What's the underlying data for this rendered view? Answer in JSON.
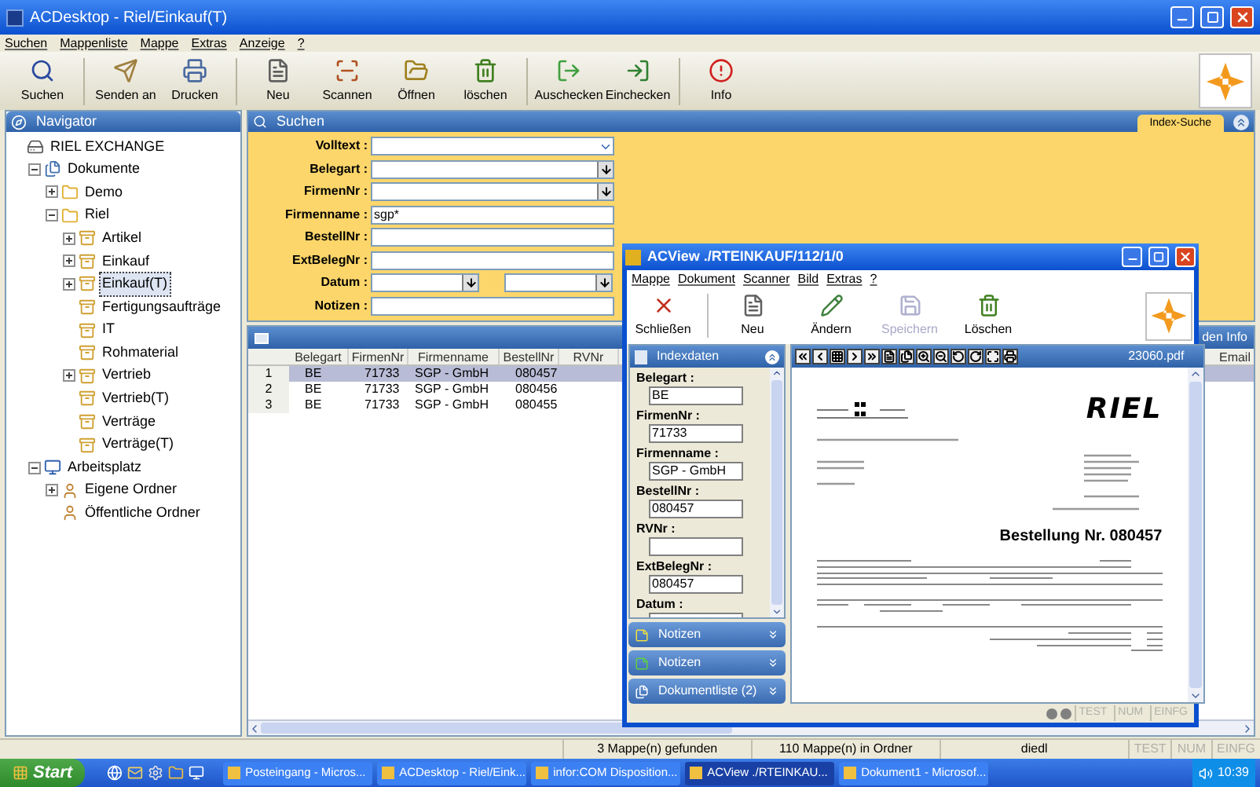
{
  "window": {
    "title": "ACDesktop - Riel/Einkauf(T)"
  },
  "menu": [
    "Suchen",
    "Mappenliste",
    "Mappe",
    "Extras",
    "Anzeige",
    "?"
  ],
  "toolbar": [
    {
      "label": "Suchen",
      "kind": "search"
    },
    {
      "label": "Senden an",
      "kind": "send",
      "separator_before": true
    },
    {
      "label": "Drucken",
      "kind": "print"
    },
    {
      "label": "Neu",
      "kind": "new",
      "separator_before": true
    },
    {
      "label": "Scannen",
      "kind": "scan"
    },
    {
      "label": "Öffnen",
      "kind": "open"
    },
    {
      "label": "löschen",
      "kind": "delete"
    },
    {
      "label": "Auschecken",
      "kind": "checkout",
      "separator_before": true
    },
    {
      "label": "Einchecken",
      "kind": "checkin"
    },
    {
      "label": "Info",
      "kind": "info",
      "separator_before": true
    }
  ],
  "navigator": {
    "title": "Navigator",
    "tree": [
      {
        "label": "RIEL EXCHANGE",
        "kind": "root",
        "selected": false,
        "children": [
          {
            "label": "Dokumente",
            "kind": "docs",
            "expanded": true,
            "selected": false,
            "children": [
              {
                "label": "Demo",
                "kind": "folder",
                "expanded": false,
                "selected": false
              },
              {
                "label": "Riel",
                "kind": "folder",
                "expanded": true,
                "selected": false,
                "children": [
                  {
                    "label": "Artikel",
                    "kind": "archive",
                    "expanded": false,
                    "selected": false
                  },
                  {
                    "label": "Einkauf",
                    "kind": "archive",
                    "expanded": false,
                    "selected": false
                  },
                  {
                    "label": "Einkauf(T)",
                    "kind": "archive",
                    "expanded": false,
                    "selected": true
                  },
                  {
                    "label": "Fertigungsaufträge",
                    "kind": "archive",
                    "selected": false
                  },
                  {
                    "label": "IT",
                    "kind": "archive",
                    "selected": false
                  },
                  {
                    "label": "Rohmaterial",
                    "kind": "archive",
                    "selected": false
                  },
                  {
                    "label": "Vertrieb",
                    "kind": "archive",
                    "expanded": false,
                    "selected": false
                  },
                  {
                    "label": "Vertrieb(T)",
                    "kind": "archive",
                    "selected": false
                  },
                  {
                    "label": "Verträge",
                    "kind": "archive",
                    "selected": false
                  },
                  {
                    "label": "Verträge(T)",
                    "kind": "archive",
                    "selected": false
                  }
                ]
              }
            ]
          },
          {
            "label": "Arbeitsplatz",
            "kind": "workplace",
            "expanded": true,
            "selected": false,
            "children": [
              {
                "label": "Eigene Ordner",
                "kind": "user",
                "expanded": false,
                "selected": false
              },
              {
                "label": "Öffentliche Ordner",
                "kind": "user",
                "selected": false
              }
            ]
          }
        ]
      }
    ]
  },
  "search": {
    "title": "Suchen",
    "tab": "Index-Suche",
    "fields": [
      {
        "label": "Volltext :",
        "kind": "dropdown"
      },
      {
        "label": "Belegart :",
        "kind": "combo"
      },
      {
        "label": "FirmenNr :",
        "kind": "combo"
      },
      {
        "label": "Firmenname :",
        "kind": "text",
        "value": "sgp*"
      },
      {
        "label": "BestellNr :",
        "kind": "text"
      },
      {
        "label": "ExtBelegNr :",
        "kind": "text"
      },
      {
        "label": "Datum :",
        "kind": "range"
      },
      {
        "label": "Notizen :",
        "kind": "text"
      }
    ]
  },
  "results": {
    "header_text": "den Info",
    "columns": [
      "Belegart",
      "FirmenNr",
      "Firmenname",
      "BestellNr",
      "RVNr",
      "Email"
    ],
    "rows": [
      {
        "number": "1",
        "cells": [
          "BE",
          "71733",
          "SGP - GmbH",
          "080457"
        ],
        "selected": true
      },
      {
        "number": "2",
        "cells": [
          "BE",
          "71733",
          "SGP - GmbH",
          "080456"
        ],
        "selected": false
      },
      {
        "number": "3",
        "cells": [
          "BE",
          "71733",
          "SGP - GmbH",
          "080455"
        ],
        "selected": false
      }
    ]
  },
  "status_bar": {
    "texts": [
      "3 Mappe(n) gefunden",
      "110 Mappe(n) in Ordner",
      "diedl"
    ],
    "indicators": [
      "TEST",
      "NUM",
      "EINFG"
    ]
  },
  "dialog": {
    "title": "ACView ./RTEINKAUF/112/1/0",
    "menu": [
      "Mappe",
      "Dokument",
      "Scanner",
      "Bild",
      "Extras",
      "?"
    ],
    "toolbar": [
      {
        "label": "Schließen",
        "kind": "close",
        "disabled": false
      },
      {
        "label": "Neu",
        "kind": "new",
        "disabled": false,
        "separator_before": true
      },
      {
        "label": "Ändern",
        "kind": "edit",
        "disabled": false
      },
      {
        "label": "Speichern",
        "kind": "save",
        "disabled": true
      },
      {
        "label": "Löschen",
        "kind": "delete",
        "disabled": false
      }
    ],
    "index_panel": {
      "title": "Indexdaten",
      "fields": [
        {
          "label": "Belegart :",
          "value": "BE"
        },
        {
          "label": "FirmenNr :",
          "value": "71733"
        },
        {
          "label": "Firmenname :",
          "value": "SGP - GmbH"
        },
        {
          "label": "BestellNr :",
          "value": "080457"
        },
        {
          "label": "RVNr :"
        },
        {
          "label": "ExtBelegNr :",
          "value": "080457"
        },
        {
          "label": "Datum :"
        }
      ]
    },
    "sections": [
      {
        "title": "Notizen",
        "kind": "note"
      },
      {
        "title": "Notizen",
        "kind": "sticky"
      },
      {
        "title": "Dokumentliste (2)",
        "kind": "doclist"
      }
    ],
    "viewer": {
      "filename": "23060.pdf",
      "logo": "RIEL",
      "heading": "Bestellung Nr. 080457"
    },
    "indicators": [
      "TEST",
      "NUM",
      "EINFG"
    ]
  },
  "taskbar": {
    "start": "Start",
    "tasks": [
      {
        "label": "Posteingang - Micros...",
        "selected": false
      },
      {
        "label": "ACDesktop - Riel/Eink...",
        "selected": false
      },
      {
        "label": "infor:COM Disposition...",
        "selected": false
      },
      {
        "label": "ACView ./RTEINKAU...",
        "selected": true
      },
      {
        "label": "Dokument1 - Microsof...",
        "selected": false
      }
    ],
    "clock": "10:39"
  }
}
